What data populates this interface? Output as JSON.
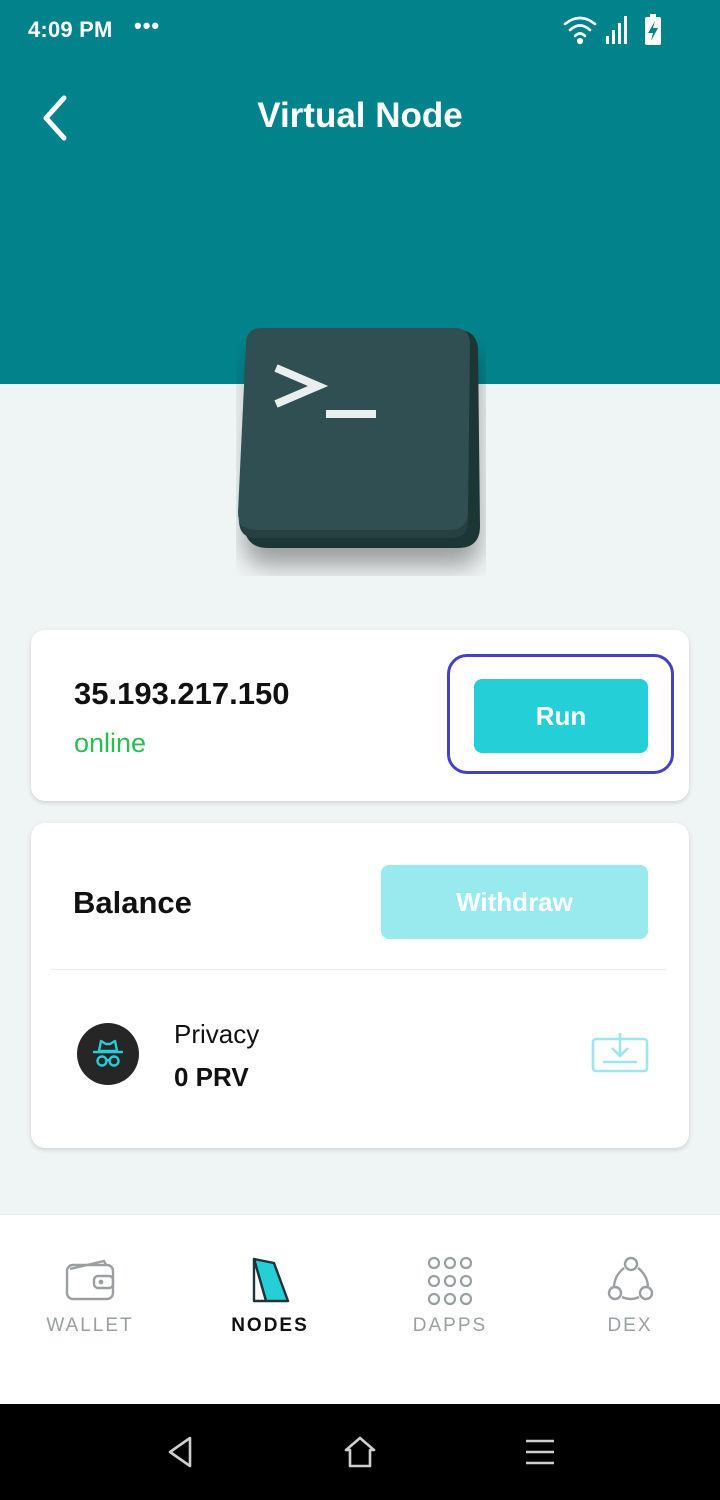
{
  "status_bar": {
    "time": "4:09 PM",
    "dots": "•••"
  },
  "header": {
    "title": "Virtual Node"
  },
  "node": {
    "ip": "35.193.217.150",
    "status": "online",
    "run_label": "Run"
  },
  "balance": {
    "label": "Balance",
    "withdraw_label": "Withdraw",
    "coin": {
      "name": "Privacy",
      "amount": "0 PRV",
      "icon": "incognito-icon"
    }
  },
  "tabs": [
    {
      "label": "WALLET",
      "icon": "wallet-icon",
      "active": false
    },
    {
      "label": "NODES",
      "icon": "node-icon",
      "active": true
    },
    {
      "label": "DAPPS",
      "icon": "grid-icon",
      "active": false
    },
    {
      "label": "DEX",
      "icon": "dex-icon",
      "active": false
    }
  ],
  "colors": {
    "header": "#02838b",
    "accent": "#25cfd8",
    "accent_disabled": "#99eaee",
    "online": "#2bbc53",
    "focus_ring": "#4640c6"
  }
}
